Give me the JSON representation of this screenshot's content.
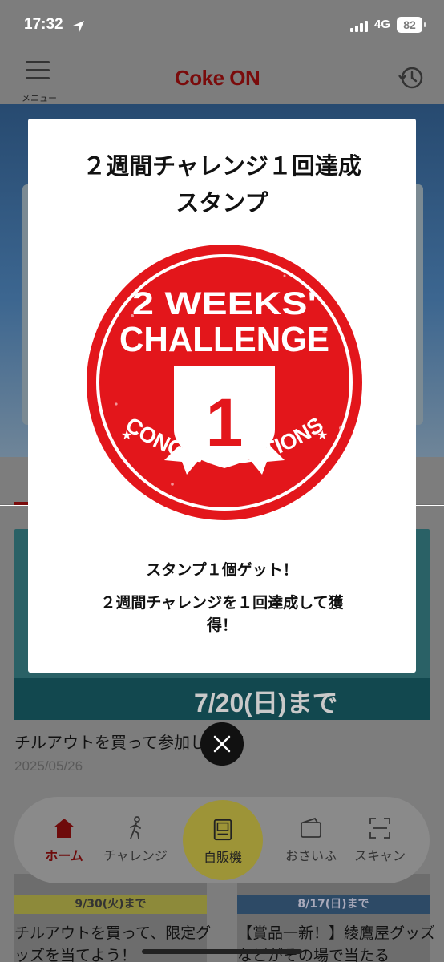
{
  "status_bar": {
    "time": "17:32",
    "network": "4G",
    "battery": "82"
  },
  "header": {
    "menu_label": "メニュー",
    "logo_text": "Coke ON"
  },
  "news": {
    "image_caption": "7/20(日)まで",
    "title": "チルアウトを買って参加しよう！",
    "date": "2025/05/26"
  },
  "cards": [
    {
      "tag": "9/30(火)まで",
      "title": "チルアウトを買って、限定グッズを当てよう！"
    },
    {
      "tag": "8/17(日)まで",
      "title": "【賞品一新！】綾鷹屋グッズなどがその場で当たる"
    }
  ],
  "bottom_nav": {
    "home": "ホーム",
    "challenge": "チャレンジ",
    "vending": "自販機",
    "wallet": "おさいふ",
    "scan": "スキャン"
  },
  "modal": {
    "title": "２週間チャレンジ１回達成\nスタンプ",
    "stamp": {
      "line1": "2 WEEKS'",
      "line2": "CHALLENGE",
      "number": "1",
      "ribbon": "CONGRATULATIONS"
    },
    "message1": "スタンプ１個ゲット！",
    "message2": "２週間チャレンジを１回達成して獲得！"
  },
  "colors": {
    "accent": "#e3161b",
    "overlay": "#7d7d7d"
  }
}
